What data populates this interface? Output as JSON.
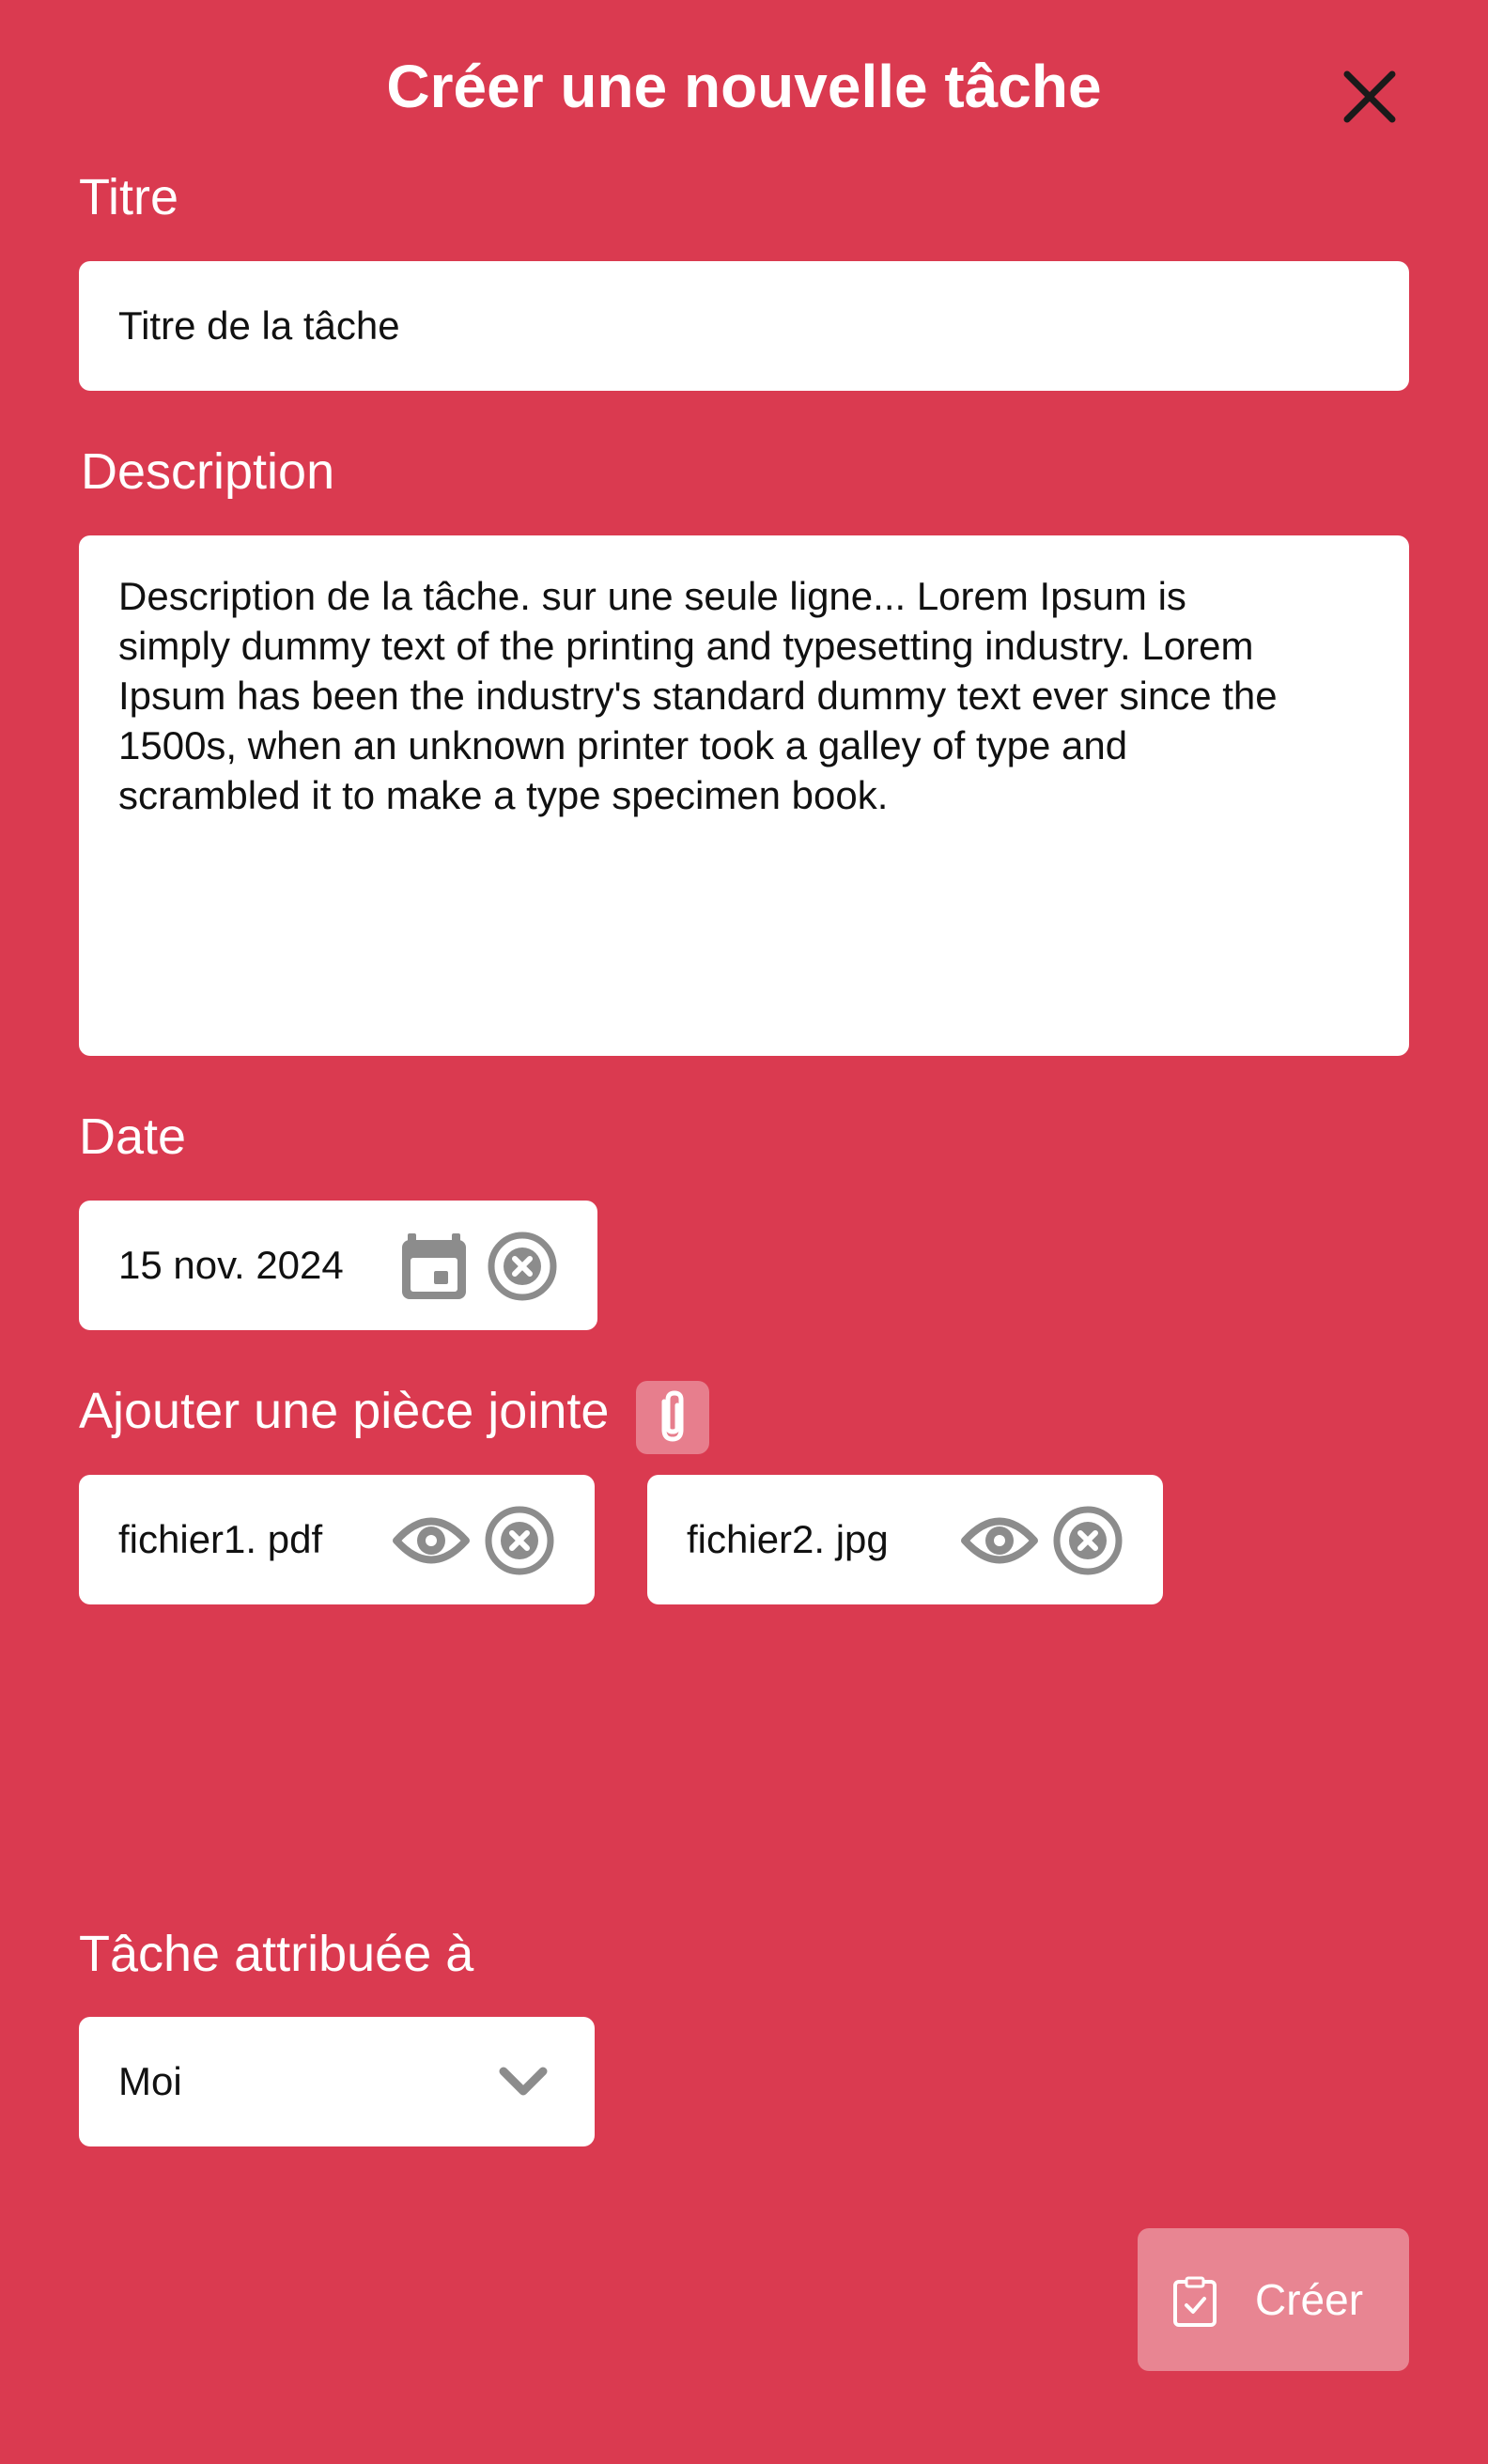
{
  "dialog": {
    "title": "Créer une nouvelle tâche",
    "close_icon": "close-icon"
  },
  "form": {
    "title_label": "Titre",
    "title_value": "Titre de la tâche",
    "description_label": "Description",
    "description_value": "Description de la tâche. sur une seule ligne... Lorem Ipsum is\nsimply dummy text of the printing and  typesetting industry. Lorem\nIpsum has been the industry's standard dummy text ever since the\n1500s, when an unknown printer took a galley of  type and\nscrambled it to make a type specimen book.",
    "date_label": "Date",
    "date_value": "15 nov. 2024",
    "attachment_label": "Ajouter une pièce jointe",
    "attachments": [
      {
        "name": "fichier1. pdf"
      },
      {
        "name": "fichier2. jpg"
      }
    ],
    "assignee_label": "Tâche attribuée à",
    "assignee_value": "Moi"
  },
  "actions": {
    "create_label": "Créer"
  },
  "colors": {
    "background": "#DA3A50",
    "field": "#FFFFFF",
    "icon_gray": "#8C8C8C"
  }
}
